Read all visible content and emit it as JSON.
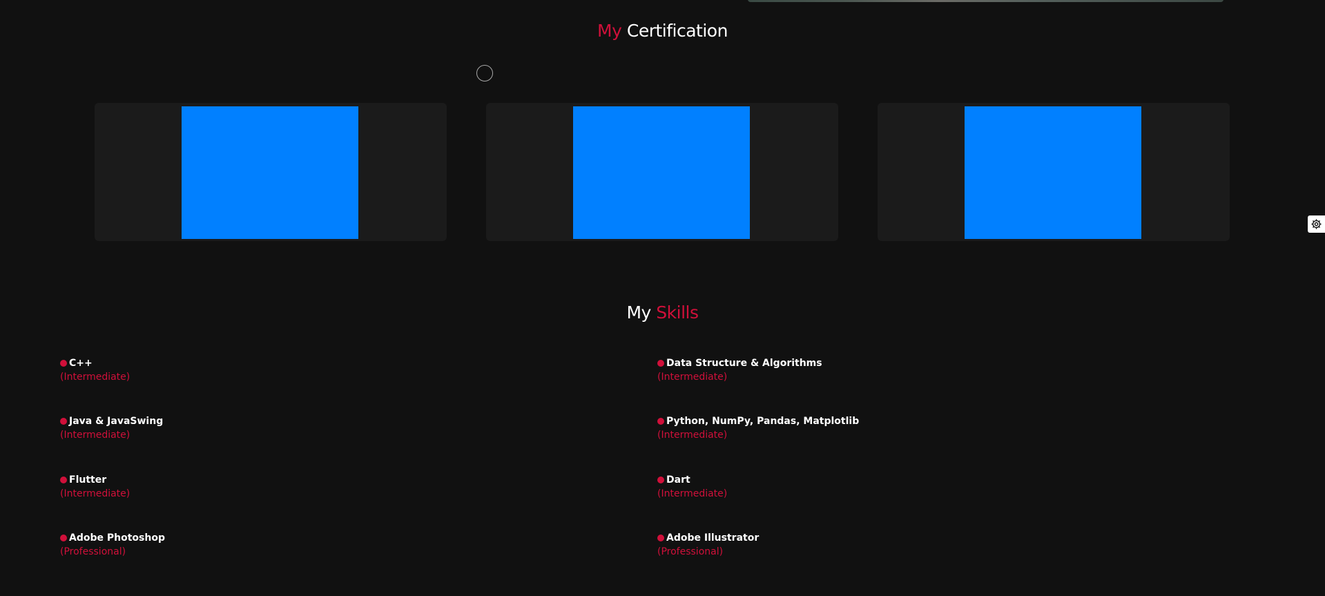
{
  "certification": {
    "title_accent": "My",
    "title_rest": "Certification",
    "cards": [
      {
        "thumb_color": "#0180ff"
      },
      {
        "thumb_color": "#0180ff"
      },
      {
        "thumb_color": "#0180ff"
      }
    ]
  },
  "skills": {
    "title_plain": "My",
    "title_accent": "Skills",
    "items": [
      {
        "name": "C++",
        "level": "(Intermediate)"
      },
      {
        "name": "Data Structure & Algorithms",
        "level": "(Intermediate)"
      },
      {
        "name": "Java & JavaSwing",
        "level": "(Intermediate)"
      },
      {
        "name": "Python, NumPy, Pandas, Matplotlib",
        "level": "(Intermediate)"
      },
      {
        "name": "Flutter",
        "level": "(Intermediate)"
      },
      {
        "name": "Dart",
        "level": "(Intermediate)"
      },
      {
        "name": "Adobe Photoshop",
        "level": "(Professional)"
      },
      {
        "name": "Adobe Illustrator",
        "level": "(Professional)"
      }
    ]
  },
  "colors": {
    "background": "#111111",
    "card": "#1b1b1b",
    "accent": "#d0103a",
    "thumb": "#0180ff"
  },
  "icons": {
    "settings": "gear-icon",
    "cursor": "cursor-ring-icon"
  }
}
